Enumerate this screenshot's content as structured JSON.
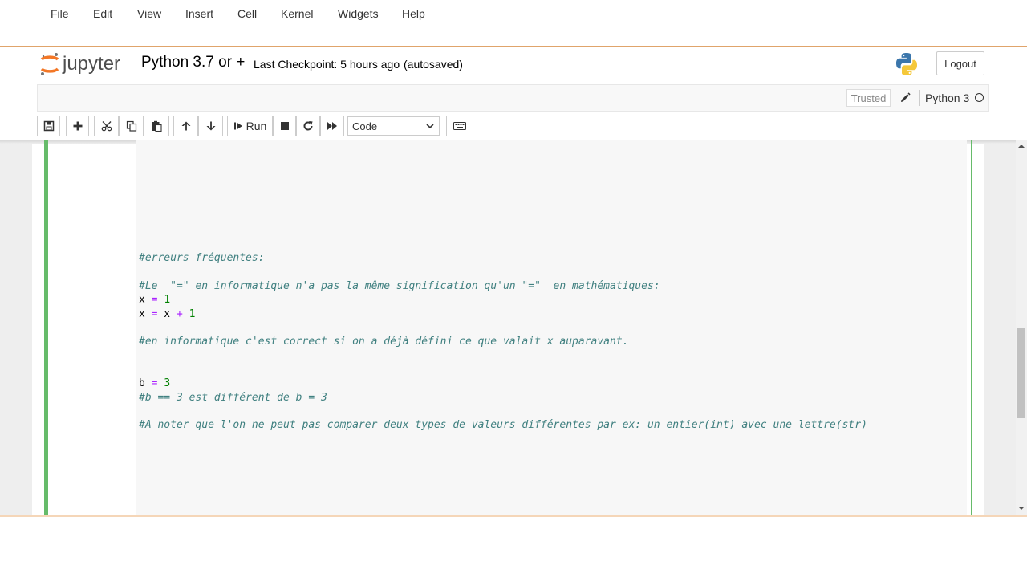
{
  "header": {
    "logo_text": "jupyter",
    "notebook_name": "Python 3.7 or +",
    "checkpoint": "Last Checkpoint: 5 hours ago",
    "autosaved": "(autosaved)",
    "logout_label": "Logout"
  },
  "menu": {
    "items": [
      "File",
      "Edit",
      "View",
      "Insert",
      "Cell",
      "Kernel",
      "Widgets",
      "Help"
    ],
    "trusted": "Trusted",
    "kernel_name": "Python 3"
  },
  "toolbar": {
    "run_label": "Run",
    "cell_type": "Code",
    "icons": [
      "save-icon",
      "plus-icon",
      "cut-icon",
      "copy-icon",
      "paste-icon",
      "arrow-up-icon",
      "arrow-down-icon",
      "step-forward-icon",
      "stop-icon",
      "restart-icon",
      "fast-forward-icon",
      "keyboard-icon"
    ]
  },
  "cell": {
    "lines": [
      {
        "tokens": [
          {
            "t": "#erreurs fréquentes:",
            "c": "comment"
          }
        ]
      },
      {
        "tokens": [
          {
            "t": "#Le  \"=\" en informatique n'a pas la même signification qu'un \"=\"  en mathématiques:",
            "c": "comment"
          }
        ]
      },
      {
        "tokens": [
          {
            "t": "x ",
            "c": "var"
          },
          {
            "t": "=",
            "c": "op"
          },
          {
            "t": " ",
            "c": "var"
          },
          {
            "t": "1",
            "c": "num"
          }
        ]
      },
      {
        "tokens": [
          {
            "t": "x ",
            "c": "var"
          },
          {
            "t": "=",
            "c": "op"
          },
          {
            "t": " x ",
            "c": "var"
          },
          {
            "t": "+",
            "c": "op"
          },
          {
            "t": " ",
            "c": "var"
          },
          {
            "t": "1",
            "c": "num"
          }
        ]
      },
      {
        "tokens": [
          {
            "t": "#en informatique c'est correct si on a déjà défini ce que valait x auparavant.",
            "c": "comment"
          }
        ]
      },
      {
        "tokens": [
          {
            "t": "b ",
            "c": "var"
          },
          {
            "t": "=",
            "c": "op"
          },
          {
            "t": " ",
            "c": "var"
          },
          {
            "t": "3",
            "c": "num"
          }
        ]
      },
      {
        "tokens": [
          {
            "t": "#b == 3 est différent de b = 3",
            "c": "comment"
          }
        ]
      },
      {
        "tokens": [
          {
            "t": "#A noter que l'on ne peut pas comparer deux types de valeurs différentes par ex: un entier(int) avec une lettre(str)",
            "c": "comment"
          }
        ]
      }
    ]
  },
  "colors": {
    "accent": "#e0a46b",
    "cell_selected": "#66bb6a",
    "comment": "#408080",
    "operator": "#aa22ff",
    "number": "#008000"
  }
}
